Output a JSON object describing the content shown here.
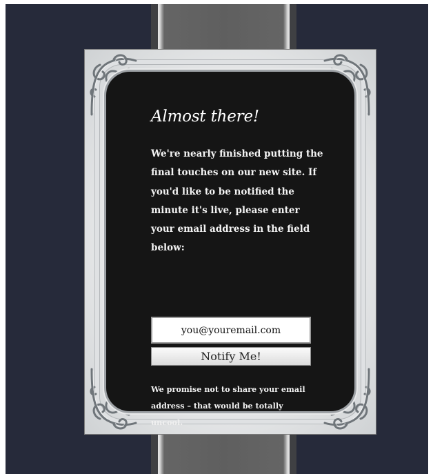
{
  "page": {
    "background": "#262a3a",
    "stripe_color": "#5f5f5f",
    "panel_color": "#151515"
  },
  "signup": {
    "title": "Almost there!",
    "intro_lines": [
      "We're nearly finished putting the",
      "final touches on our new site. If",
      "you'd like to be notified the",
      "minute it's live, please enter",
      "your email address in the field",
      "below:"
    ],
    "email_placeholder": "you@youremail.com",
    "email_value": "",
    "button_label": "Notify Me!",
    "fineprint_lines": [
      "We promise not to share your email",
      "address – that would be totally",
      "uncool."
    ]
  },
  "decoration": {
    "corner_ornament_icon": "scroll-flourish-icon"
  }
}
